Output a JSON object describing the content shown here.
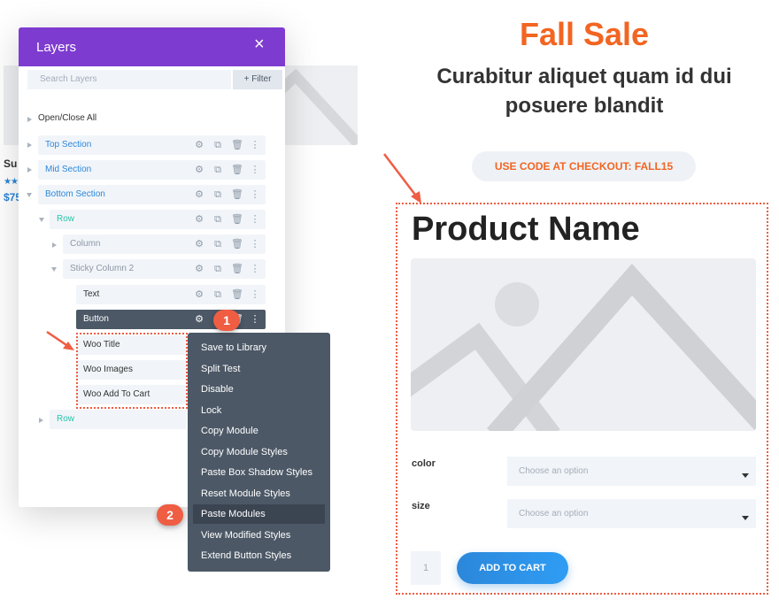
{
  "background_page": {
    "product_title": "Su",
    "stars": "★★",
    "price": "$75"
  },
  "layers_panel": {
    "title": "Layers",
    "close": "×",
    "search_placeholder": "Search Layers",
    "filter_label": "+ Filter",
    "open_close_all": "Open/Close All",
    "items": [
      {
        "label": "Top Section"
      },
      {
        "label": "Mid Section"
      },
      {
        "label": "Bottom Section"
      },
      {
        "label": "Row"
      },
      {
        "label": "Column"
      },
      {
        "label": "Sticky Column 2"
      },
      {
        "label": "Text"
      },
      {
        "label": "Button"
      },
      {
        "label": "Woo Title"
      },
      {
        "label": "Woo Images"
      },
      {
        "label": "Woo Add To Cart"
      },
      {
        "label": "Row"
      }
    ]
  },
  "context_menu": {
    "items": [
      "Save to Library",
      "Split Test",
      "Disable",
      "Lock",
      "Copy Module",
      "Copy Module Styles",
      "Paste Box Shadow Styles",
      "Reset Module Styles",
      "Paste Modules",
      "View Modified Styles",
      "Extend Button Styles"
    ]
  },
  "badges": {
    "step1": "1",
    "step2": "2"
  },
  "page": {
    "headline": "Fall Sale",
    "subheadline": "Curabitur aliquet quam id dui posuere blandit",
    "promo_code": "USE CODE AT CHECKOUT: FALL15",
    "product_name": "Product Name",
    "color_label": "color",
    "size_label": "size",
    "select_placeholder": "Choose an option",
    "quantity": "1",
    "add_to_cart": "ADD TO CART"
  },
  "colors": {
    "panel_header": "#7e3bd0",
    "accent_orange": "#f26522",
    "annotation_red": "#ef5d43",
    "button_blue": "#2b87da",
    "menu_bg": "#4c5866"
  }
}
